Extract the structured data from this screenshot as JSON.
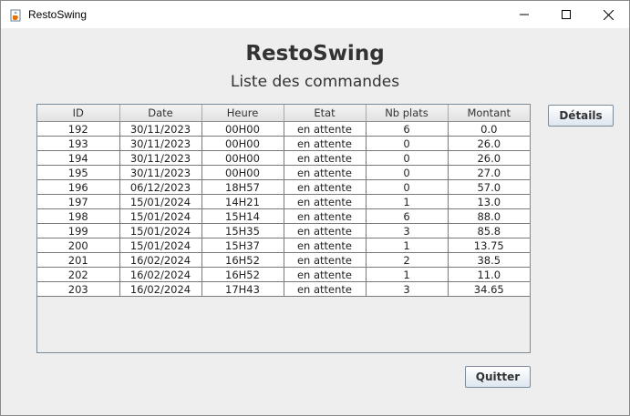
{
  "window": {
    "title": "RestoSwing",
    "icon": "java-cup-icon"
  },
  "header": {
    "title": "RestoSwing",
    "subtitle": "Liste des commandes"
  },
  "table": {
    "columns": [
      "ID",
      "Date",
      "Heure",
      "Etat",
      "Nb plats",
      "Montant"
    ],
    "rows": [
      [
        "192",
        "30/11/2023",
        "00H00",
        "en attente",
        "6",
        "0.0"
      ],
      [
        "193",
        "30/11/2023",
        "00H00",
        "en attente",
        "0",
        "26.0"
      ],
      [
        "194",
        "30/11/2023",
        "00H00",
        "en attente",
        "0",
        "26.0"
      ],
      [
        "195",
        "30/11/2023",
        "00H00",
        "en attente",
        "0",
        "27.0"
      ],
      [
        "196",
        "06/12/2023",
        "18H57",
        "en attente",
        "0",
        "57.0"
      ],
      [
        "197",
        "15/01/2024",
        "14H21",
        "en attente",
        "1",
        "13.0"
      ],
      [
        "198",
        "15/01/2024",
        "15H14",
        "en attente",
        "6",
        "88.0"
      ],
      [
        "199",
        "15/01/2024",
        "15H35",
        "en attente",
        "3",
        "85.8"
      ],
      [
        "200",
        "15/01/2024",
        "15H37",
        "en attente",
        "1",
        "13.75"
      ],
      [
        "201",
        "16/02/2024",
        "16H52",
        "en attente",
        "2",
        "38.5"
      ],
      [
        "202",
        "16/02/2024",
        "16H52",
        "en attente",
        "1",
        "11.0"
      ],
      [
        "203",
        "16/02/2024",
        "17H43",
        "en attente",
        "3",
        "34.65"
      ]
    ]
  },
  "buttons": {
    "details": "Détails",
    "quit": "Quitter"
  }
}
